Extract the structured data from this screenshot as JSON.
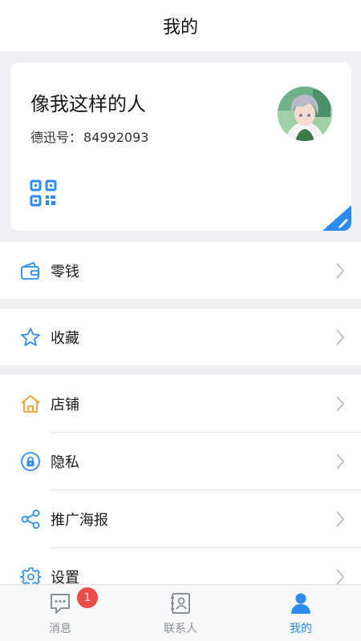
{
  "header": {
    "title": "我的"
  },
  "profile": {
    "name": "像我这样的人",
    "id_label": "德迅号：",
    "id_value": "84992093"
  },
  "menu": {
    "wallet": "零钱",
    "favorites": "收藏",
    "shop": "店铺",
    "privacy": "隐私",
    "poster": "推广海报",
    "settings": "设置"
  },
  "tabs": {
    "messages": {
      "label": "消息",
      "badge": "1"
    },
    "contacts": {
      "label": "联系人"
    },
    "me": {
      "label": "我的"
    }
  },
  "colors": {
    "accent": "#2d8cf0",
    "shop_icon": "#f0a030",
    "badge": "#ee4b4b",
    "page_bg": "#eef0f3"
  }
}
